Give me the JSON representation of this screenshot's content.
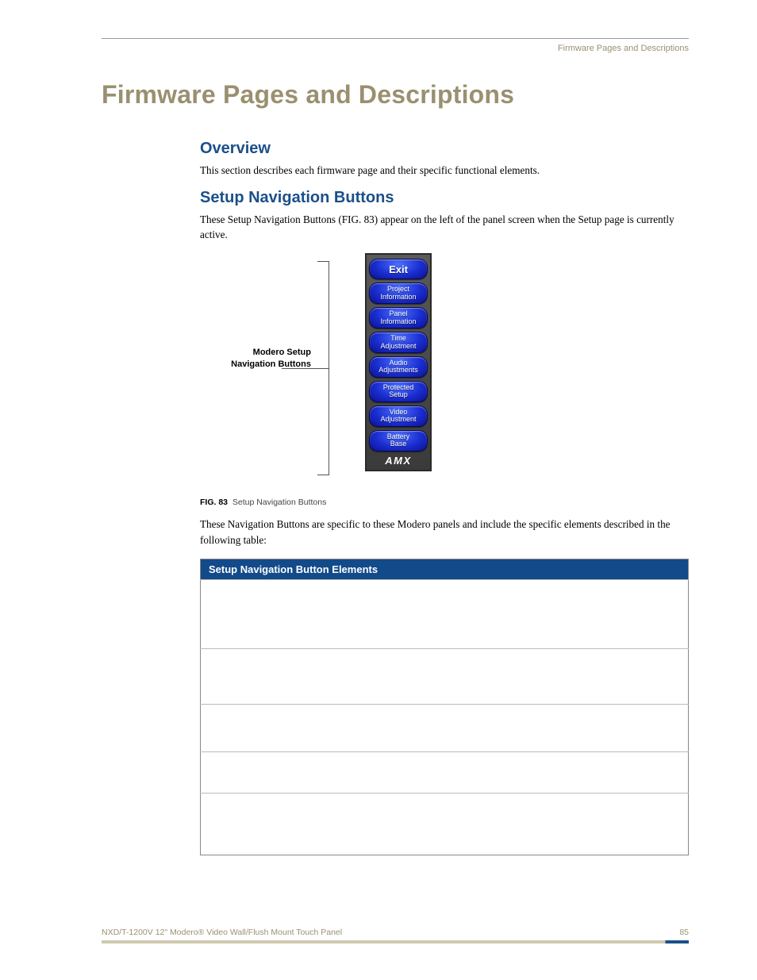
{
  "running_head": "Firmware Pages and Descriptions",
  "h1": "Firmware Pages and Descriptions",
  "sections": {
    "overview": {
      "title": "Overview",
      "body": "This section describes each firmware page and their specific functional elements."
    },
    "setup_nav": {
      "title": "Setup Navigation Buttons",
      "body1": "These Setup Navigation Buttons (FIG. 83) appear on the left of the panel screen when the Setup page is currently active.",
      "body2": "These Navigation Buttons are specific to these Modero panels and include the specific elements described in the following table:"
    }
  },
  "figure": {
    "side_label": "Modero Setup\nNavigation Buttons",
    "buttons": [
      "Exit",
      "Project\nInformation",
      "Panel\nInformation",
      "Time\nAdjustment",
      "Audio\nAdjustments",
      "Protected\nSetup",
      "Video\nAdjustment",
      "Battery\nBase"
    ],
    "logo": "AMX",
    "caption_num": "FIG. 83",
    "caption_text": "Setup Navigation Buttons"
  },
  "table": {
    "header": "Setup Navigation Button Elements"
  },
  "footer": {
    "doc": "NXD/T-1200V 12\" Modero® Video Wall/Flush Mount Touch Panel",
    "page": "85"
  }
}
